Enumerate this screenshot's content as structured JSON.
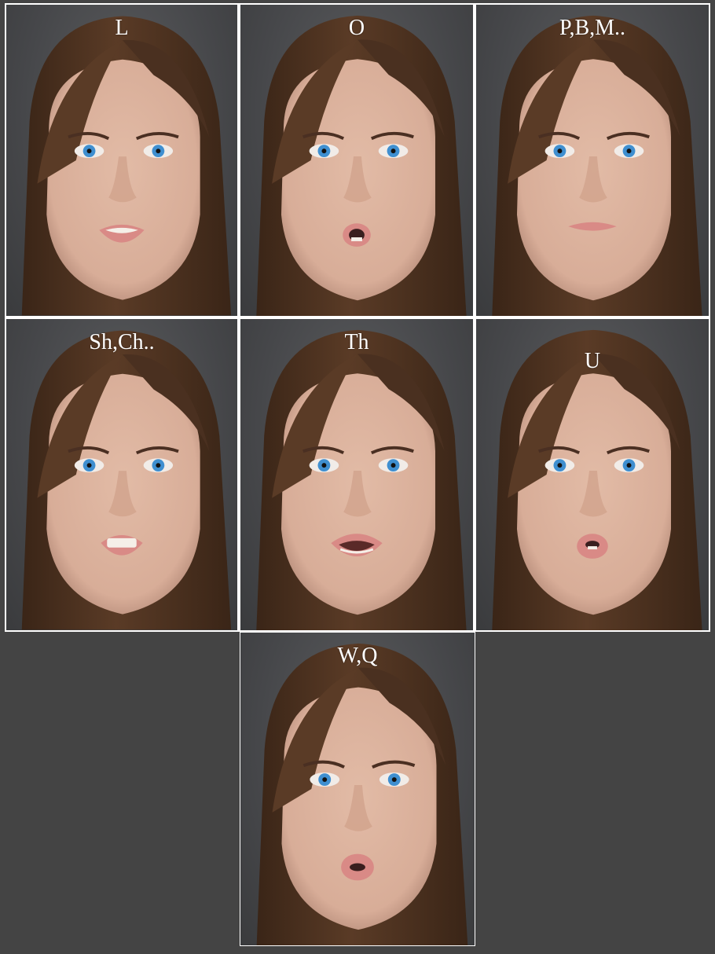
{
  "panels": [
    {
      "label": "L",
      "mouth": "open-teeth"
    },
    {
      "label": "O",
      "mouth": "o-round"
    },
    {
      "label": "P,B,M..",
      "mouth": "closed"
    },
    {
      "label": "Sh,Ch..",
      "mouth": "teeth-clenched"
    },
    {
      "label": "Th",
      "mouth": "wide-open"
    },
    {
      "label": "U",
      "mouth": "pucker-small"
    },
    {
      "label": "W,Q",
      "mouth": "pucker"
    }
  ],
  "colors": {
    "background": "#444444",
    "panel_border": "#ffffff",
    "label_text": "#ffffff",
    "hair": "#5a3b26",
    "skin": "#d8ad98",
    "lips": "#d98a86",
    "iris": "#3f8fd0"
  }
}
